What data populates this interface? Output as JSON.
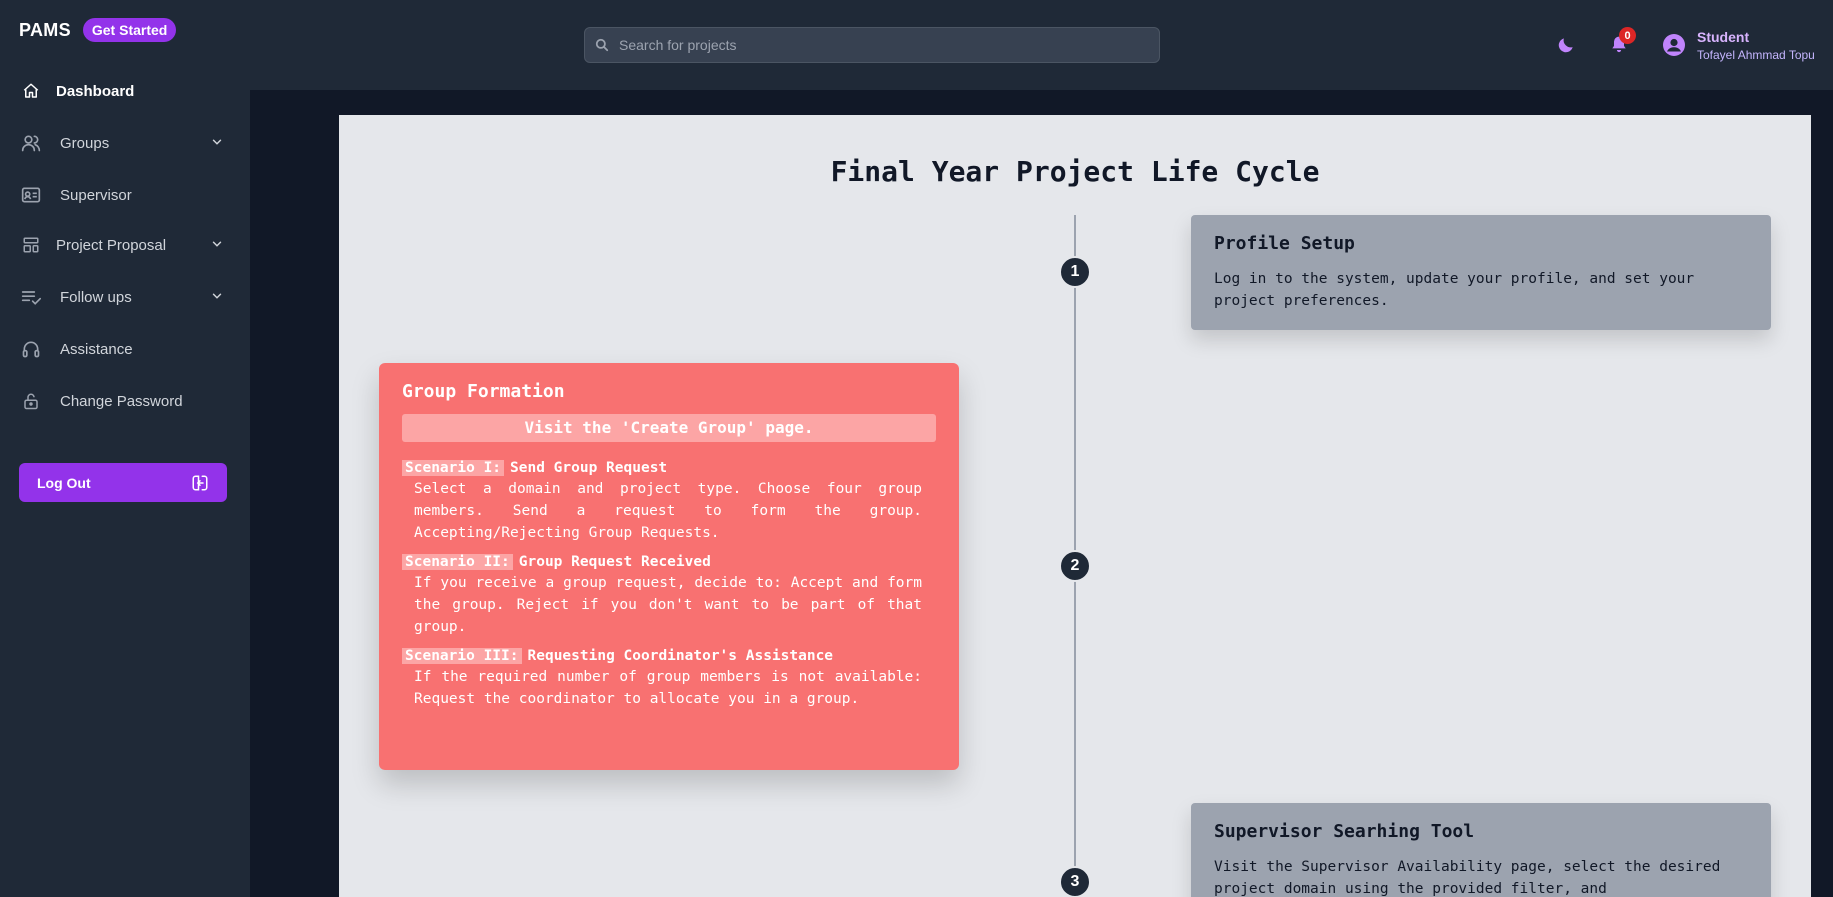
{
  "brand": {
    "name": "PAMS",
    "badge": "Get Started"
  },
  "sidebar": {
    "items": [
      {
        "label": "Dashboard",
        "icon": "home-icon",
        "active": true
      },
      {
        "label": "Groups",
        "icon": "users-icon",
        "has_submenu": true
      },
      {
        "label": "Supervisor",
        "icon": "id-card-icon"
      },
      {
        "label": "Project Proposal",
        "icon": "layout-icon",
        "has_submenu": true
      },
      {
        "label": "Follow ups",
        "icon": "checklist-icon",
        "has_submenu": true
      },
      {
        "label": "Assistance",
        "icon": "headset-icon"
      },
      {
        "label": "Change Password",
        "icon": "lock-icon"
      }
    ],
    "logout_label": "Log Out"
  },
  "header": {
    "search_placeholder": "Search for projects",
    "notification_count": "0",
    "user_role": "Student",
    "user_name": "Tofayel Ahmmad Topu"
  },
  "main": {
    "title": "Final Year Project Life Cycle",
    "steps": [
      "1",
      "2",
      "3"
    ],
    "profile_card": {
      "title": "Profile Setup",
      "body": "Log in to the system, update your profile, and set your project preferences."
    },
    "group_card": {
      "title": "Group Formation",
      "visit": "Visit the 'Create Group' page.",
      "scenarios": [
        {
          "tag": "Scenario I:",
          "heading": "Send Group Request",
          "body": "Select a domain and project type. Choose four group members. Send a request to form the group. Accepting/Rejecting Group Requests."
        },
        {
          "tag": "Scenario II:",
          "heading": "Group Request Received",
          "body": "If you receive a group request, decide to: Accept and form the group. Reject if you don't want to be part of that group."
        },
        {
          "tag": "Scenario III:",
          "heading": "Requesting Coordinator's Assistance",
          "body": "If the required number of group members is not available: Request the coordinator to allocate you in a group."
        }
      ]
    },
    "supervisor_card": {
      "title": "Supervisor Searhing Tool",
      "body": "Visit the Supervisor Availability page, select the desired project domain using the provided filter, and"
    }
  },
  "colors": {
    "accent": "#9333ea",
    "sidebar_bg": "#1f2937",
    "content_bg": "#e5e7eb",
    "red_card": "#f87171",
    "gray_card": "#9ca3af"
  }
}
